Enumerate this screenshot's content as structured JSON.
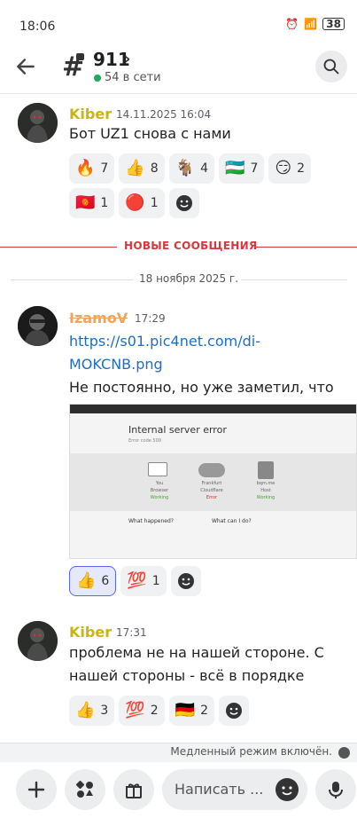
{
  "status_bar": {
    "time": "18:06",
    "battery": "38"
  },
  "header": {
    "channel_name": "911",
    "online": "54 в сети"
  },
  "dividers": {
    "new_messages": "НОВЫЕ СООБЩЕНИЯ",
    "date": "18 ноября 2025 г."
  },
  "messages": [
    {
      "author": "Kiber",
      "author_color": "#c9b417",
      "time": "14.11.2025 16:04",
      "text": "Бот UZ1 снова с нами",
      "reactions": [
        {
          "emoji": "🔥",
          "count": "7"
        },
        {
          "emoji": "👍",
          "count": "8"
        },
        {
          "emoji": "🐐",
          "count": "4"
        },
        {
          "emoji": "🇺🇿",
          "count": "7"
        },
        {
          "emoji": "😏",
          "count": "2"
        },
        {
          "emoji": "🇰🇬",
          "count": "1"
        },
        {
          "emoji": "🔴",
          "count": "1"
        }
      ]
    },
    {
      "author": "IzamoV",
      "author_color": "#f0a55a",
      "time": "17:29",
      "link": "https://s01.pic4net.com/di-MOKCNB.png",
      "text": "Не постоянно, но уже заметил, что пару раз так",
      "image": {
        "title": "Internal server error",
        "subtitle": "Error code 500",
        "badge": "Error code 500",
        "nodes": [
          {
            "name": "You",
            "label": "Browser",
            "status": "Working"
          },
          {
            "name": "Frankfurt",
            "label": "Cloudflare",
            "status": "Error"
          },
          {
            "name": "bqm.me",
            "label": "Host",
            "status": "Working"
          }
        ],
        "what_happened": "What happened?",
        "what_can_i_do": "What can I do?"
      },
      "reactions": [
        {
          "emoji": "👍",
          "count": "6",
          "active": true
        },
        {
          "emoji": "💯",
          "count": "1"
        }
      ]
    },
    {
      "author": "Kiber",
      "author_color": "#c9b417",
      "time": "17:31",
      "text": "проблема не на нашей стороне. С нашей стороны - всё в порядке",
      "reactions": [
        {
          "emoji": "👍",
          "count": "3"
        },
        {
          "emoji": "💯",
          "count": "2"
        },
        {
          "emoji": "🇩🇪",
          "count": "2"
        }
      ]
    }
  ],
  "slow_mode": "Медленный режим включён.",
  "composer": {
    "placeholder": "Написать ..."
  },
  "colors": {
    "accent": "#5865f2",
    "new_divider": "#da373c",
    "link": "#1a6fc7",
    "online": "#23a55a"
  }
}
